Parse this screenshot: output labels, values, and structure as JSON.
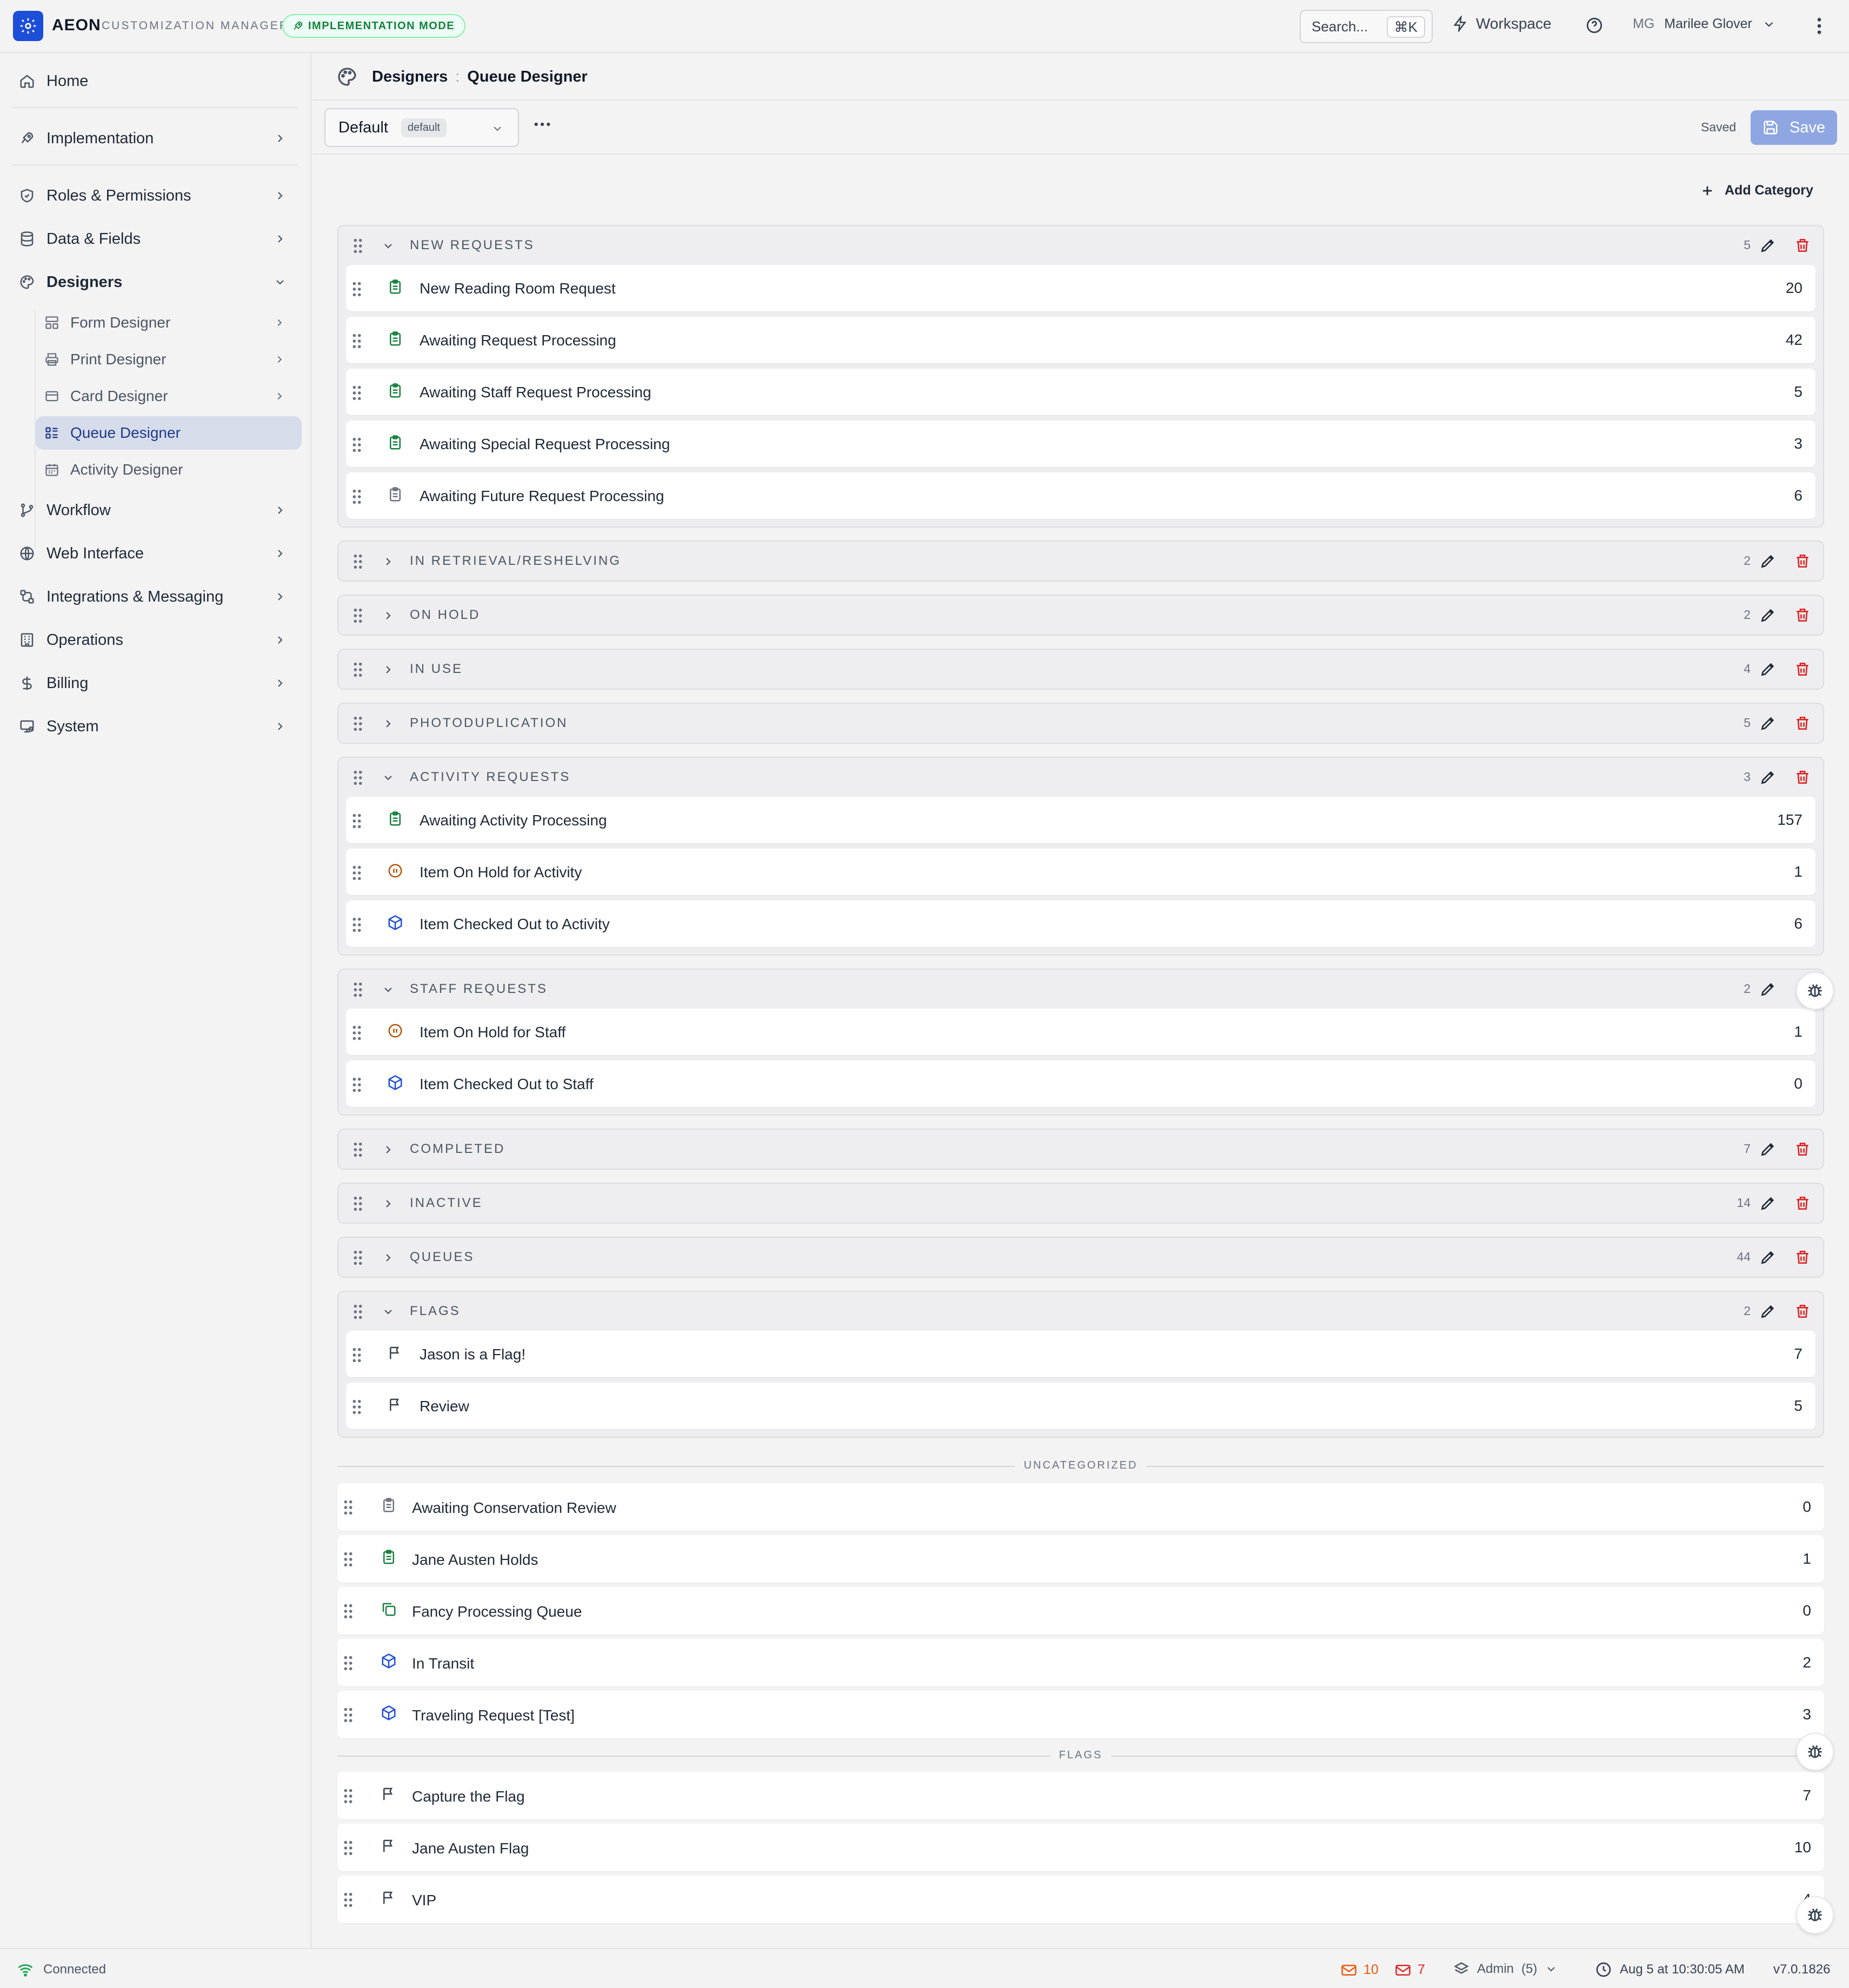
{
  "app": {
    "brand": "AEON",
    "subtitle": "CUSTOMIZATION MANAGER",
    "mode_badge": "IMPLEMENTATION MODE",
    "search_label": "Search...",
    "search_shortcut": "⌘K",
    "workspace_label": "Workspace",
    "user_initials": "MG",
    "user_name": "Marilee Glover",
    "accent_color": "#1d4ed8",
    "success_color": "#15803d",
    "danger_color": "#dc2626"
  },
  "sidebar": {
    "items": [
      {
        "label": "Home",
        "icon": "home-icon"
      },
      {
        "label": "Implementation",
        "icon": "rocket-icon"
      },
      {
        "label": "Roles & Permissions",
        "icon": "shield-icon"
      },
      {
        "label": "Data & Fields",
        "icon": "database-icon"
      },
      {
        "label": "Designers",
        "icon": "palette-icon"
      },
      {
        "label": "Workflow",
        "icon": "git-branch-icon"
      },
      {
        "label": "Web Interface",
        "icon": "globe-icon"
      },
      {
        "label": "Integrations & Messaging",
        "icon": "integration-icon"
      },
      {
        "label": "Operations",
        "icon": "building-icon"
      },
      {
        "label": "Billing",
        "icon": "dollar-icon"
      },
      {
        "label": "System",
        "icon": "monitor-icon"
      }
    ],
    "designers": [
      {
        "label": "Form Designer",
        "icon": "form-layout-icon"
      },
      {
        "label": "Print Designer",
        "icon": "printer-icon"
      },
      {
        "label": "Card Designer",
        "icon": "card-icon"
      },
      {
        "label": "Queue Designer",
        "icon": "queue-list-icon"
      },
      {
        "label": "Activity Designer",
        "icon": "calendar-icon"
      }
    ]
  },
  "breadcrumb": {
    "parent": "Designers",
    "separator": ":",
    "current": "Queue Designer"
  },
  "toolbar": {
    "view_name": "Default",
    "view_tag": "default",
    "saved_label": "Saved",
    "save_label": "Save",
    "add_category_label": "Add Category"
  },
  "categories": [
    {
      "title": "NEW REQUESTS",
      "count": "5",
      "expanded": true,
      "rows": [
        {
          "name": "New Reading Room Request",
          "count": "20",
          "icon": "clipboard-icon",
          "color": "#15803d"
        },
        {
          "name": "Awaiting Request Processing",
          "count": "42",
          "icon": "clipboard-icon",
          "color": "#15803d"
        },
        {
          "name": "Awaiting Staff Request Processing",
          "count": "5",
          "icon": "clipboard-icon",
          "color": "#15803d"
        },
        {
          "name": "Awaiting Special Request Processing",
          "count": "3",
          "icon": "clipboard-icon",
          "color": "#15803d"
        },
        {
          "name": "Awaiting Future Request Processing",
          "count": "6",
          "icon": "clipboard-icon",
          "color": "#6b7280"
        }
      ]
    },
    {
      "title": "IN RETRIEVAL/RESHELVING",
      "count": "2",
      "expanded": false,
      "rows": []
    },
    {
      "title": "ON HOLD",
      "count": "2",
      "expanded": false,
      "rows": []
    },
    {
      "title": "IN USE",
      "count": "4",
      "expanded": false,
      "rows": []
    },
    {
      "title": "PHOTODUPLICATION",
      "count": "5",
      "expanded": false,
      "rows": []
    },
    {
      "title": "ACTIVITY REQUESTS",
      "count": "3",
      "expanded": true,
      "rows": [
        {
          "name": "Awaiting Activity Processing",
          "count": "157",
          "icon": "clipboard-icon",
          "color": "#15803d"
        },
        {
          "name": "Item On Hold for Activity",
          "count": "1",
          "icon": "pause-circle-icon",
          "color": "#b45309"
        },
        {
          "name": "Item Checked Out to Activity",
          "count": "6",
          "icon": "package-icon",
          "color": "#1d4ed8"
        }
      ]
    },
    {
      "title": "STAFF REQUESTS",
      "count": "2",
      "expanded": true,
      "rows": [
        {
          "name": "Item On Hold for Staff",
          "count": "1",
          "icon": "pause-circle-icon",
          "color": "#b45309"
        },
        {
          "name": "Item Checked Out to Staff",
          "count": "0",
          "icon": "package-icon",
          "color": "#1d4ed8"
        }
      ]
    },
    {
      "title": "COMPLETED",
      "count": "7",
      "expanded": false,
      "rows": []
    },
    {
      "title": "INACTIVE",
      "count": "14",
      "expanded": false,
      "rows": []
    },
    {
      "title": "QUEUES",
      "count": "44",
      "expanded": false,
      "rows": []
    },
    {
      "title": "FLAGS",
      "count": "2",
      "expanded": true,
      "rows": [
        {
          "name": "Jason is a Flag!",
          "count": "7",
          "icon": "flag-icon",
          "color": "#374151"
        },
        {
          "name": "Review",
          "count": "5",
          "icon": "flag-icon",
          "color": "#374151"
        }
      ]
    }
  ],
  "uncategorized": {
    "label": "UNCATEGORIZED",
    "rows": [
      {
        "name": "Awaiting Conservation Review",
        "count": "0",
        "icon": "clipboard-icon",
        "color": "#6b7280"
      },
      {
        "name": "Jane Austen Holds",
        "count": "1",
        "icon": "clipboard-icon",
        "color": "#15803d"
      },
      {
        "name": "Fancy Processing Queue",
        "count": "0",
        "icon": "copy-icon",
        "color": "#15803d"
      },
      {
        "name": "In Transit",
        "count": "2",
        "icon": "package-icon",
        "color": "#1d4ed8"
      },
      {
        "name": "Traveling Request [Test]",
        "count": "3",
        "icon": "package-icon",
        "color": "#1d4ed8"
      }
    ]
  },
  "flags_section": {
    "label": "FLAGS",
    "rows": [
      {
        "name": "Capture the Flag",
        "count": "7",
        "icon": "flag-icon",
        "color": "#374151"
      },
      {
        "name": "Jane Austen Flag",
        "count": "10",
        "icon": "flag-icon",
        "color": "#374151"
      },
      {
        "name": "VIP",
        "count": "4",
        "icon": "flag-icon",
        "color": "#374151"
      }
    ]
  },
  "footer": {
    "status": "Connected",
    "mail_unread": "10",
    "mail_failed": "7",
    "role": "Admin",
    "role_count": "(5)",
    "datetime": "Aug 5 at 10:30:05 AM",
    "version": "v7.0.1826"
  }
}
